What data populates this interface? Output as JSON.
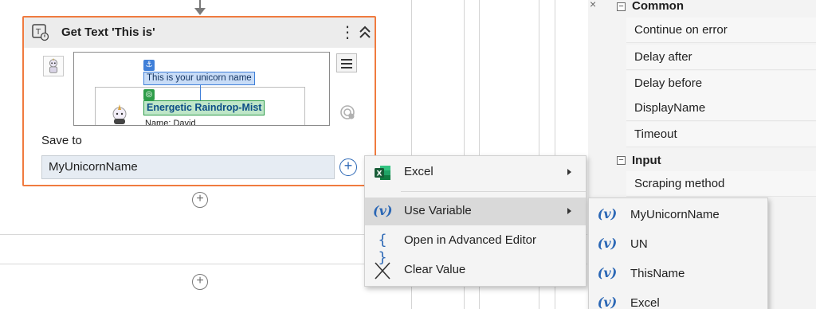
{
  "activity": {
    "title": "Get Text 'This is'",
    "kebab_glyph": "⋮",
    "icon": "get-text-icon",
    "preview": {
      "anchor_text": "This is your unicorn name",
      "target_text": "Energetic Raindrop-Mist",
      "cutoff_text": "Name: David"
    },
    "save_to_label": "Save to",
    "save_to_value": "MyUnicornName",
    "plus_glyph": "+"
  },
  "canvas": {
    "add_glyph": "+"
  },
  "properties": {
    "close_glyph": "×",
    "sections": [
      {
        "name": "Common",
        "toggle": "−",
        "rows": [
          "Continue on error",
          "Delay after",
          "Delay before",
          "DisplayName",
          "Timeout"
        ]
      },
      {
        "name": "Input",
        "toggle": "−",
        "rows": [
          "Scraping method"
        ]
      }
    ]
  },
  "context_menu": {
    "items": [
      {
        "label": "Excel",
        "icon": "excel-icon",
        "has_submenu": true
      },
      {
        "label": "Use Variable",
        "icon": "variable-icon",
        "icon_glyph": "(v)",
        "has_submenu": true,
        "highlighted": true
      },
      {
        "label": "Open in Advanced Editor",
        "icon": "braces-icon",
        "icon_glyph": "{ }"
      },
      {
        "label": "Clear Value",
        "icon": "close-x-icon"
      }
    ]
  },
  "variable_submenu": {
    "items": [
      "MyUnicornName",
      "UN",
      "ThisName",
      "Excel"
    ],
    "icon_glyph": "(v)"
  },
  "colors": {
    "activity_border": "#f07b3f",
    "anchor_blue": "#3f7fd8",
    "target_green": "#2e9d49",
    "variable_blue": "#2b67b5",
    "menu_highlight": "#d9d9d9"
  }
}
